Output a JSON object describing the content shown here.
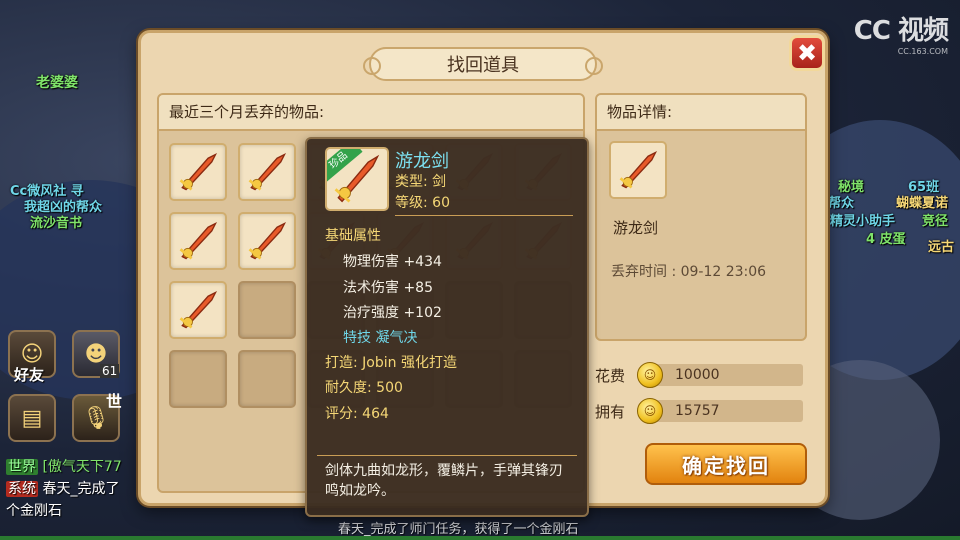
{
  "dialog": {
    "title": "找回道具",
    "close_label": "✖",
    "list_header": "最近三个月丢弃的物品:",
    "detail_header": "物品详情:",
    "detail_name": "游龙剑",
    "discard_time": "丢弃时间 : 09-12 23:06",
    "cost_label": "花费",
    "cost_value": "10000",
    "owned_label": "拥有",
    "owned_value": "15757",
    "confirm_label": "确定找回"
  },
  "inventory": {
    "filled_slots": 5,
    "visible_slots": 12,
    "item_icon": "sword-icon"
  },
  "tooltip": {
    "badge": "珍品",
    "name": "游龙剑",
    "type": "类型: 剑",
    "level": "等级: 60",
    "base_header": "基础属性",
    "attr_physical": "物理伤害  +434",
    "attr_magic": "法术伤害  +85",
    "attr_heal": "治疗强度  +102",
    "special": "特技  凝气决",
    "forge": "打造: Jobin  强化打造",
    "durability": "耐久度: 500",
    "score": "评分: 464",
    "description": "剑体九曲如龙形，覆鳞片，手弹其锋刃鸣如龙吟。"
  },
  "scene": {
    "npc_1": "老婆婆",
    "npc_2": "Cc微风社 寻",
    "npc_3": "我超凶的帮众",
    "npc_4": "流沙音书",
    "npc_5": "秘境",
    "npc_6": "65班",
    "npc_7": "帮众",
    "npc_8": "蝴蝶夏诺",
    "npc_9": "精灵小助手",
    "npc_10": "远古",
    "npc_11": "竞径",
    "npc_12": "4 皮蛋",
    "friend_label": "好友",
    "level_badge": "61",
    "chat_world_tag": "世界",
    "chat_world_text": "[傲气天下77",
    "chat_system_tag": "系统",
    "chat_system_text": "春天_完成了",
    "chat_line3": "个金刚石",
    "chat_bottom": "春天_完成了师门任务，获得了一个金刚石",
    "watermark": "CC 视频",
    "watermark_sub": "CC.163.COM",
    "mic_label": "世"
  },
  "colors": {
    "panel_bg": "#ecd6b0",
    "accent_orange": "#e2830f",
    "tooltip_bg": "#3a2c20",
    "name_cyan": "#7ce0f0",
    "stat_yellow": "#f5d776",
    "close_red": "#c9342a"
  }
}
